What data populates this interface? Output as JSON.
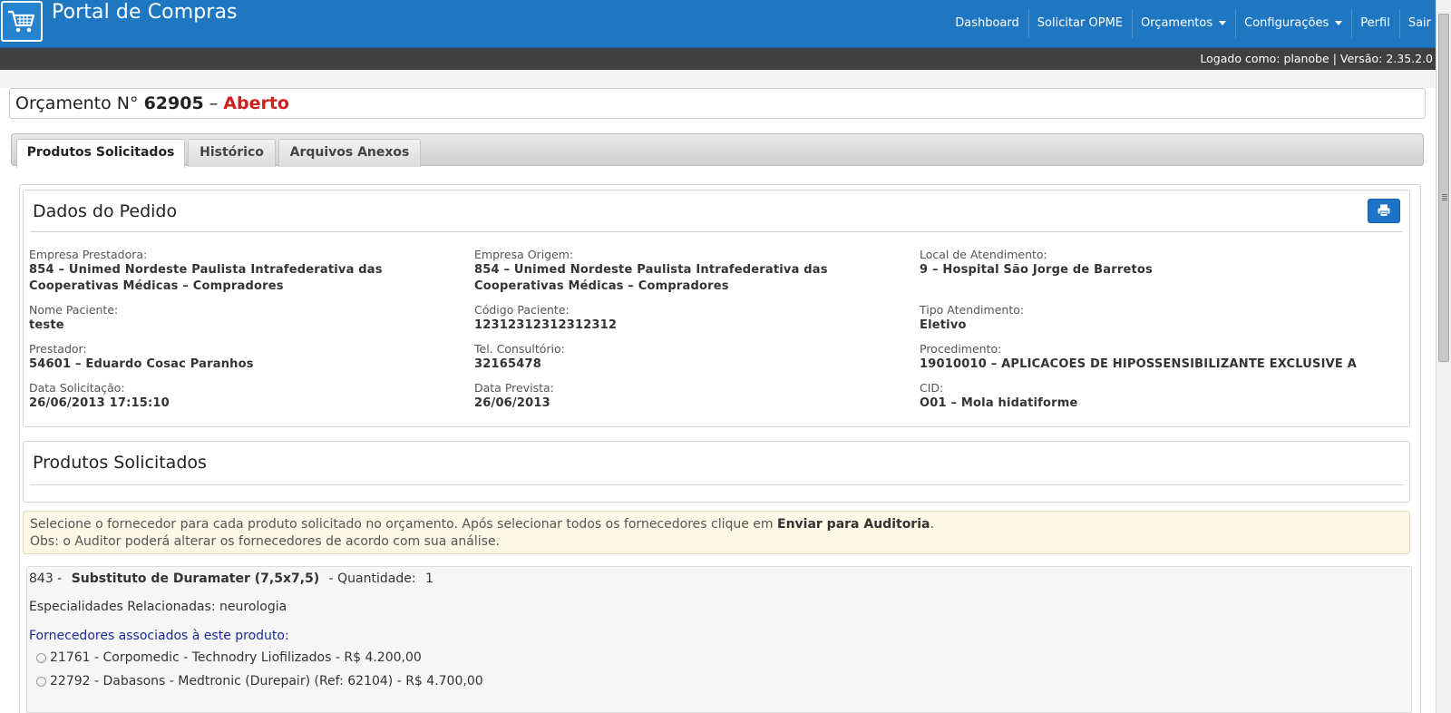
{
  "header": {
    "brand_title": "Portal de Compras",
    "nav": [
      {
        "label": "Dashboard"
      },
      {
        "label": "Solicitar OPME"
      },
      {
        "label": "Orçamentos"
      },
      {
        "label": "Configurações"
      },
      {
        "label": "Perfil"
      },
      {
        "label": "Sair"
      }
    ],
    "status": "Logado como: planobe | Versão: 2.35.2.0"
  },
  "page": {
    "title_prefix": "Orçamento N°",
    "number": "62905",
    "separator": "–",
    "status": "Aberto",
    "status_color": "#d01f1f"
  },
  "tabs": [
    {
      "label": "Produtos Solicitados"
    },
    {
      "label": "Histórico"
    },
    {
      "label": "Arquivos Anexos"
    }
  ],
  "pedido": {
    "heading": "Dados do Pedido",
    "fields": [
      {
        "label": "Empresa Prestadora:",
        "value": "854 – Unimed Nordeste Paulista Intrafederativa das Cooperativas Médicas – Compradores"
      },
      {
        "label": "Empresa Origem:",
        "value": "854 – Unimed Nordeste Paulista Intrafederativa das Cooperativas Médicas – Compradores"
      },
      {
        "label": "Local de Atendimento:",
        "value": "9 – Hospital São Jorge de Barretos"
      },
      {
        "label": "Nome Paciente:",
        "value": "teste"
      },
      {
        "label": "Código Paciente:",
        "value": "12312312312312312"
      },
      {
        "label": "Tipo Atendimento:",
        "value": "Eletivo"
      },
      {
        "label": "Prestador:",
        "value": "54601 – Eduardo Cosac Paranhos"
      },
      {
        "label": "Tel. Consultório:",
        "value": "32165478"
      },
      {
        "label": "Procedimento:",
        "value": "19010010 – APLICACOES DE HIPOSSENSIBILIZANTE EXCLUSIVE A"
      },
      {
        "label": "Data Solicitação:",
        "value": "26/06/2013 17:15:10"
      },
      {
        "label": "Data Prevista:",
        "value": "26/06/2013"
      },
      {
        "label": "CID:",
        "value": "O01 – Mola hidatiforme"
      }
    ]
  },
  "produtos": {
    "heading": "Produtos Solicitados"
  },
  "alert": {
    "line1_before": "Selecione o fornecedor para cada produto solicitado no orçamento. Após selecionar todos os fornecedores clique em",
    "line1_bold": "Enviar para Auditoria",
    "line1_after": ".",
    "line2": "Obs: o Auditor poderá alterar os fornecedores de acordo com sua análise."
  },
  "product": {
    "code": "843 -",
    "name": "Substituto de Duramater (7,5x7,5)",
    "quantity_label": "- Quantidade:",
    "quantity": "1",
    "especialidades": "Especialidades Relacionadas: neurologia",
    "fornecedores_title": "Fornecedores associados à este produto:",
    "options": [
      {
        "label": "21761 - Corpomedic - Technodry Liofilizados - R$ 4.200,00"
      },
      {
        "label": "22792 - Dabasons - Medtronic (Durepair) (Ref: 62104) - R$ 4.700,00"
      }
    ]
  },
  "colors": {
    "navbar": "#1f77c2",
    "statusbar": "#404040",
    "print_button": "#1f73c7",
    "alert_bg": "#fcf8e5",
    "fornecedores_title": "#1a2b8f"
  }
}
